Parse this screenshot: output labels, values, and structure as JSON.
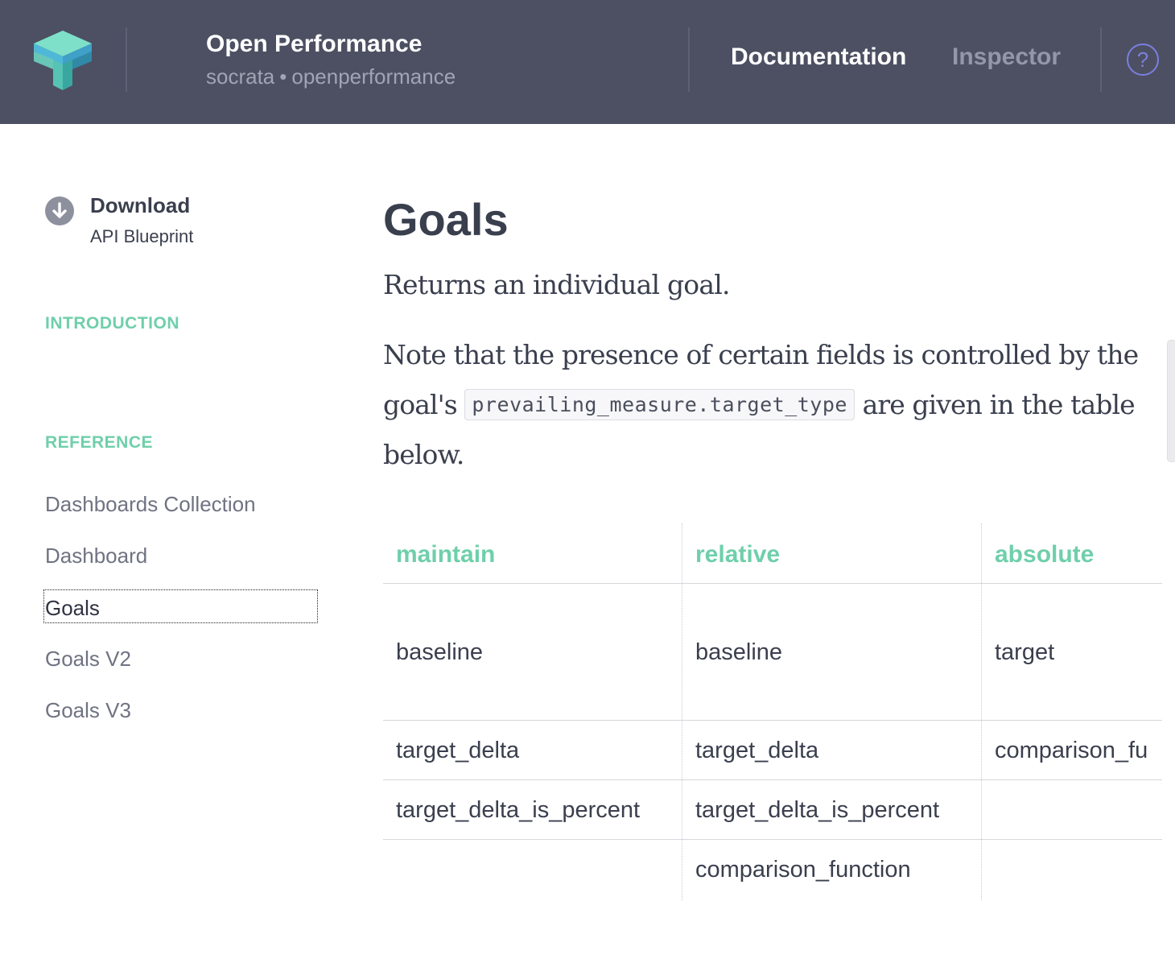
{
  "header": {
    "app_title": "Open Performance",
    "org": "socrata",
    "separator": "•",
    "project": "openperformance",
    "nav": {
      "documentation": "Documentation",
      "inspector": "Inspector"
    },
    "help_label": "?"
  },
  "sidebar": {
    "download": {
      "title": "Download",
      "subtitle": "API Blueprint"
    },
    "sections": {
      "introduction": "INTRODUCTION",
      "reference": "REFERENCE"
    },
    "items": [
      {
        "label": "Dashboards Collection",
        "active": false
      },
      {
        "label": "Dashboard",
        "active": false
      },
      {
        "label": "Goals",
        "active": true
      },
      {
        "label": "Goals V2",
        "active": false
      },
      {
        "label": "Goals V3",
        "active": false
      }
    ]
  },
  "main": {
    "title": "Goals",
    "lead": "Returns an individual goal.",
    "para_before": "Note that the presence of certain fields is controlled by the goal's",
    "code": "prevailing_measure.target_type",
    "para_after": "are given in the table below.",
    "table": {
      "headers": [
        "maintain",
        "relative",
        "absolute"
      ],
      "rows": [
        [
          "baseline",
          "baseline",
          "target"
        ],
        [
          "target_delta",
          "target_delta",
          "comparison_fu"
        ],
        [
          "target_delta_is_percent",
          "target_delta_is_percent",
          ""
        ],
        [
          "",
          "comparison_function",
          ""
        ]
      ]
    }
  },
  "colors": {
    "header_bg": "#4c5062",
    "accent_green": "#6fcfab",
    "help_purple": "#7b7fe0",
    "text_dark": "#3a3f4e"
  }
}
